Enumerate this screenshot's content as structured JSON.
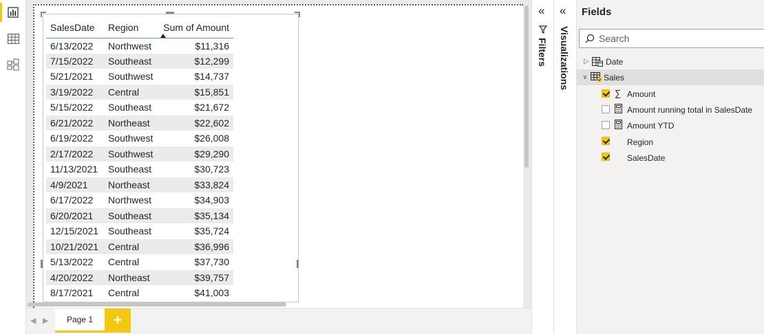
{
  "app": {
    "colors": {
      "accent": "#f2c811",
      "header_rule": "#5b9bb0",
      "row_alt": "#ebebeb",
      "pane_bg": "#f3f2f1"
    }
  },
  "leftnav": {
    "items": [
      {
        "icon": "report-view-icon",
        "active": true
      },
      {
        "icon": "data-view-icon",
        "active": false
      },
      {
        "icon": "model-view-icon",
        "active": false
      }
    ]
  },
  "table": {
    "columns": [
      "SalesDate",
      "Region",
      "Sum of Amount"
    ],
    "sort_column": "Sum of Amount",
    "sort_direction": "ascending",
    "rows": [
      [
        "6/13/2022",
        "Northwest",
        "$11,316"
      ],
      [
        "7/15/2022",
        "Southeast",
        "$12,299"
      ],
      [
        "5/21/2021",
        "Southwest",
        "$14,737"
      ],
      [
        "3/19/2022",
        "Central",
        "$15,851"
      ],
      [
        "5/15/2022",
        "Southeast",
        "$21,672"
      ],
      [
        "6/21/2022",
        "Northeast",
        "$22,602"
      ],
      [
        "6/19/2022",
        "Southwest",
        "$26,008"
      ],
      [
        "2/17/2022",
        "Southwest",
        "$29,290"
      ],
      [
        "11/13/2021",
        "Southeast",
        "$30,723"
      ],
      [
        "4/9/2021",
        "Northeast",
        "$33,824"
      ],
      [
        "6/17/2022",
        "Northwest",
        "$34,903"
      ],
      [
        "6/20/2021",
        "Southeast",
        "$35,134"
      ],
      [
        "12/15/2021",
        "Southeast",
        "$35,724"
      ],
      [
        "10/21/2021",
        "Central",
        "$36,996"
      ],
      [
        "5/13/2022",
        "Central",
        "$37,730"
      ],
      [
        "4/20/2022",
        "Northeast",
        "$39,757"
      ],
      [
        "8/17/2021",
        "Central",
        "$41,003"
      ]
    ]
  },
  "pagebar": {
    "tabs": [
      {
        "label": "Page 1",
        "active": true
      }
    ],
    "add_label": "+"
  },
  "panes": {
    "filters": {
      "label": "Filters"
    },
    "visualizations": {
      "label": "Visualizations"
    },
    "fields": {
      "title": "Fields",
      "search_placeholder": "Search",
      "tables": [
        {
          "name": "Date",
          "expanded": false
        },
        {
          "name": "Sales",
          "expanded": true
        }
      ],
      "sales_fields": [
        {
          "label": "Amount",
          "checked": true,
          "icon": "sigma-icon"
        },
        {
          "label": "Amount running total in SalesDate",
          "checked": false,
          "icon": "calculator-icon"
        },
        {
          "label": "Amount YTD",
          "checked": false,
          "icon": "calculator-icon"
        },
        {
          "label": "Region",
          "checked": true,
          "icon": ""
        },
        {
          "label": "SalesDate",
          "checked": true,
          "icon": ""
        }
      ]
    }
  }
}
